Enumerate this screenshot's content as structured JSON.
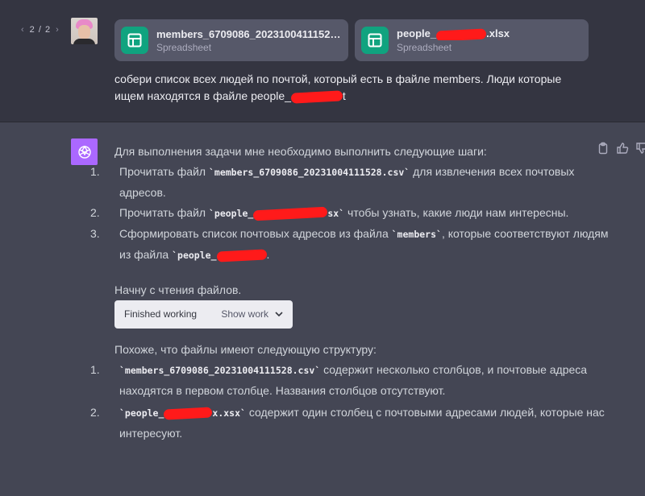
{
  "pager": {
    "prev": "‹",
    "label": "2 / 2",
    "next": "›"
  },
  "user": {
    "files": [
      {
        "name": "members_6709086_20231004111528.c...",
        "type": "Spreadsheet",
        "icon": "spreadsheet-icon"
      },
      {
        "name_prefix": "people_",
        "name_suffix": ".xlsx",
        "type": "Spreadsheet",
        "icon": "spreadsheet-icon"
      }
    ],
    "message_part1": "собери список всех людей по почтой, который есть в файле members. Люди которые ищем находятся в файле people_",
    "message_part2": "t"
  },
  "assistant": {
    "icon": "chatgpt-logo-icon",
    "intro": "Для выполнения задачи мне необходимо выполнить следующие шаги:",
    "steps": [
      {
        "num": "1.",
        "a": "Прочитать файл ",
        "code": "`members_6709086_20231004111528.csv`",
        "b": " для извлечения всех почтовых адресов."
      },
      {
        "num": "2.",
        "a": "Прочитать файл ",
        "code1": "`people_",
        "code2": "sx`",
        "b": " чтобы узнать, какие люди нам интересны."
      },
      {
        "num": "3.",
        "a": "Сформировать список почтовых адресов из файла ",
        "code": "`members`",
        "b": ", которые соответствуют людям из файла ",
        "code3": "`people_",
        "c": "."
      }
    ],
    "para2": "Начну с чтения файлов.",
    "status": {
      "label": "Finished working",
      "show": "Show work"
    },
    "para3": "Похоже, что файлы имеют следующую структуру:",
    "structure": [
      {
        "num": "1.",
        "code": "`members_6709086_20231004111528.csv`",
        "b": " содержит несколько столбцов, и почтовые адреса находятся в первом столбце. Названия столбцов отсутствуют."
      },
      {
        "num": "2.",
        "code1": "`people_",
        "code2": "x.xsx`",
        "b": " содержит один столбец с почтовыми адресами людей, которые нас интересуют."
      }
    ],
    "actions": [
      "clipboard-icon",
      "thumbs-up-icon",
      "thumbs-down-icon"
    ]
  },
  "colors": {
    "accent_green": "#10a37f",
    "bot_purple": "#ab68ff",
    "redaction": "#ff1a1a"
  }
}
